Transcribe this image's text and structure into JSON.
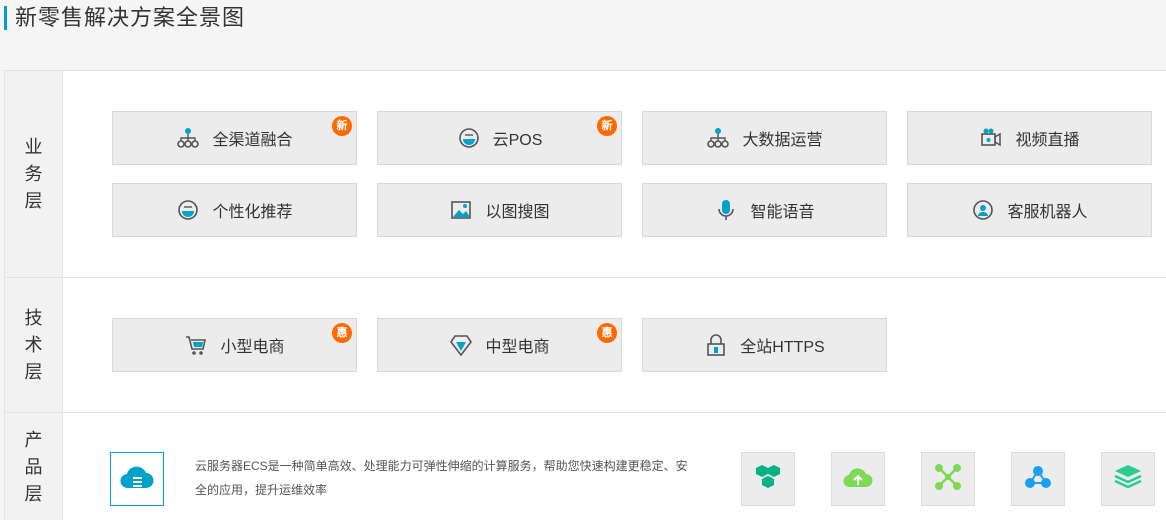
{
  "header": {
    "title": "新零售解决方案全景图"
  },
  "layers": {
    "business": {
      "label": "业务层",
      "cards": [
        {
          "label": "全渠道融合",
          "icon": "org-chart-icon",
          "badge": "新"
        },
        {
          "label": "云POS",
          "icon": "pos-icon",
          "badge": "新"
        },
        {
          "label": "大数据运营",
          "icon": "org-chart-icon",
          "badge": ""
        },
        {
          "label": "视频直播",
          "icon": "video-camera-icon",
          "badge": ""
        },
        {
          "label": "个性化推荐",
          "icon": "recommend-icon",
          "badge": ""
        },
        {
          "label": "以图搜图",
          "icon": "image-icon",
          "badge": ""
        },
        {
          "label": "智能语音",
          "icon": "microphone-icon",
          "badge": ""
        },
        {
          "label": "客服机器人",
          "icon": "robot-service-icon",
          "badge": ""
        }
      ]
    },
    "tech": {
      "label": "技术层",
      "cards": [
        {
          "label": "小型电商",
          "icon": "cart-icon",
          "badge": "惠"
        },
        {
          "label": "中型电商",
          "icon": "diamond-icon",
          "badge": "惠"
        },
        {
          "label": "全站HTTPS",
          "icon": "lock-icon",
          "badge": ""
        }
      ]
    },
    "product": {
      "label": "产品层",
      "main_icon": "cloud-server-icon",
      "description": "云服务器ECS是一种简单高效、处理能力可弹性伸缩的计算服务，帮助您快速构建更稳定、安全的应用，提升运维效率",
      "icons": [
        "hexagon-cluster-icon",
        "cloud-upload-icon",
        "network-cross-icon",
        "node-graph-icon",
        "layers-stack-icon"
      ]
    }
  },
  "colors": {
    "accent": "#00a2ca",
    "badge": "#ff6a00",
    "green": "#7ed957"
  }
}
